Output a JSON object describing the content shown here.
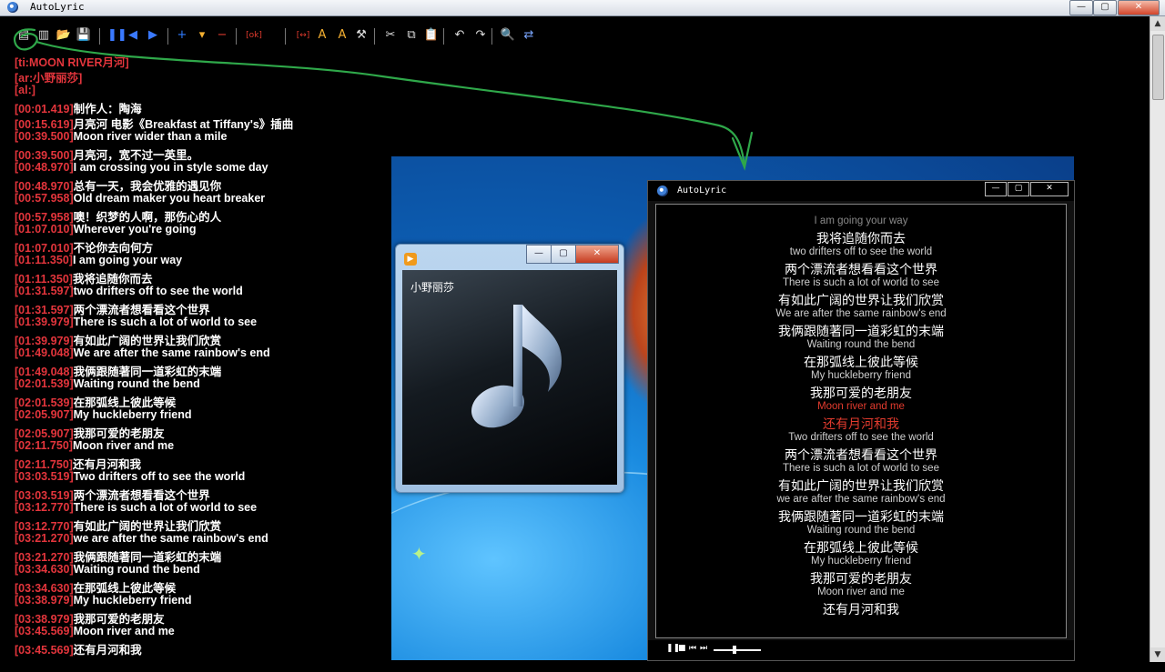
{
  "main_window": {
    "title": "AutoLyric",
    "controls": {
      "minimize": "—",
      "maximize": "▢",
      "close": "✕"
    }
  },
  "toolbar": {
    "buttons": [
      {
        "name": "new-icon",
        "glyph": "▤"
      },
      {
        "name": "list-icon",
        "glyph": "▥"
      },
      {
        "name": "open-icon",
        "glyph": "📂"
      },
      {
        "name": "save-icon",
        "glyph": "💾"
      },
      {
        "name": "pause-icon",
        "glyph": "❚❚"
      },
      {
        "name": "prev-icon",
        "glyph": "◀"
      },
      {
        "name": "next-icon",
        "glyph": "▶"
      },
      {
        "name": "add-icon",
        "glyph": "+"
      },
      {
        "name": "dropdown-icon",
        "glyph": "▾"
      },
      {
        "name": "remove-icon",
        "glyph": "−"
      },
      {
        "name": "ok-tag-icon",
        "glyph": "[ok]"
      },
      {
        "name": "range-icon",
        "glyph": "[↔]"
      },
      {
        "name": "font-size-down-icon",
        "glyph": "A"
      },
      {
        "name": "font-size-up-icon",
        "glyph": "A"
      },
      {
        "name": "tools-icon",
        "glyph": "⚒"
      },
      {
        "name": "cut-icon",
        "glyph": "✂"
      },
      {
        "name": "copy-icon",
        "glyph": "⧉"
      },
      {
        "name": "paste-icon",
        "glyph": "📋"
      },
      {
        "name": "undo-icon",
        "glyph": "↶"
      },
      {
        "name": "redo-icon",
        "glyph": "↷"
      },
      {
        "name": "find-icon",
        "glyph": "🔍"
      },
      {
        "name": "replace-icon",
        "glyph": "⇄"
      }
    ]
  },
  "editor": {
    "header_lines": [
      "[ti:MOON RIVER月河]",
      "[ar:小野丽莎]",
      "[al:]"
    ],
    "lines": [
      {
        "tag": "[00:01.419]",
        "text": "制作人：陶海"
      },
      {
        "tag": "[00:15.619]",
        "text": "月亮河 电影《Breakfast at Tiffany's》插曲"
      },
      {
        "tag": "[00:39.500]",
        "text": "Moon river wider than a mile"
      },
      {
        "tag": "[00:39.500]",
        "text": "月亮河，宽不过一英里。"
      },
      {
        "tag": "[00:48.970]",
        "text": "I am crossing you in style some day"
      },
      {
        "tag": "[00:48.970]",
        "text": "总有一天，我会优雅的遇见你"
      },
      {
        "tag": "[00:57.958]",
        "text": "Old dream maker  you heart breaker"
      },
      {
        "tag": "[00:57.958]",
        "text": "噢！织梦的人啊，那伤心的人"
      },
      {
        "tag": "[01:07.010]",
        "text": "Wherever you're going"
      },
      {
        "tag": "[01:07.010]",
        "text": "不论你去向何方"
      },
      {
        "tag": "[01:11.350]",
        "text": "I am going your way"
      },
      {
        "tag": "[01:11.350]",
        "text": "我将追随你而去"
      },
      {
        "tag": "[01:31.597]",
        "text": "two drifters off to see the world"
      },
      {
        "tag": "[01:31.597]",
        "text": "两个漂流者想看看这个世界"
      },
      {
        "tag": "[01:39.979]",
        "text": "There is such a lot of world to see"
      },
      {
        "tag": "[01:39.979]",
        "text": "有如此广阔的世界让我们欣赏"
      },
      {
        "tag": "[01:49.048]",
        "text": "We are after the same rainbow's end"
      },
      {
        "tag": "[01:49.048]",
        "text": "我俩跟随著同一道彩虹的末端"
      },
      {
        "tag": "[02:01.539]",
        "text": "Waiting round the bend"
      },
      {
        "tag": "[02:01.539]",
        "text": "在那弧线上彼此等候"
      },
      {
        "tag": "[02:05.907]",
        "text": "My huckleberry friend"
      },
      {
        "tag": "[02:05.907]",
        "text": "我那可爱的老朋友"
      },
      {
        "tag": "[02:11.750]",
        "text": "Moon river and me"
      },
      {
        "tag": "[02:11.750]",
        "text": "还有月河和我"
      },
      {
        "tag": "[03:03.519]",
        "text": "Two drifters off to see the world"
      },
      {
        "tag": "[03:03.519]",
        "text": "两个漂流者想看看这个世界"
      },
      {
        "tag": "[03:12.770]",
        "text": "There is such a lot of world to see"
      },
      {
        "tag": "[03:12.770]",
        "text": "有如此广阔的世界让我们欣赏"
      },
      {
        "tag": "[03:21.270]",
        "text": "we are after the same rainbow's end"
      },
      {
        "tag": "[03:21.270]",
        "text": "我俩跟随著同一道彩虹的末端"
      },
      {
        "tag": "[03:34.630]",
        "text": "Waiting round the bend"
      },
      {
        "tag": "[03:34.630]",
        "text": "在那弧线上彼此等候"
      },
      {
        "tag": "[03:38.979]",
        "text": "My huckleberry friend"
      },
      {
        "tag": "[03:38.979]",
        "text": "我那可爱的老朋友"
      },
      {
        "tag": "[03:45.569]",
        "text": "Moon river and me"
      },
      {
        "tag": "[03:45.569]",
        "text": "还有月河和我"
      }
    ],
    "scrollbar": {
      "up": "▲",
      "down": "▼"
    }
  },
  "media_player": {
    "artist": "小野丽莎",
    "controls": {
      "minimize": "—",
      "maximize": "▢",
      "close": "✕"
    },
    "icon_glyph": "▶"
  },
  "lyric_window": {
    "title": "AutoLyric",
    "controls": {
      "minimize": "—",
      "maximize": "▢",
      "close": "✕"
    },
    "lines": [
      {
        "text": "I am going your way",
        "lang": "en",
        "state": "dim"
      },
      {
        "text": "我将追随你而去",
        "lang": "zh",
        "state": "normal"
      },
      {
        "text": "two drifters off to see the world",
        "lang": "en",
        "state": "normal"
      },
      {
        "text": "两个漂流者想看看这个世界",
        "lang": "zh",
        "state": "normal"
      },
      {
        "text": "There is such a lot of world to see",
        "lang": "en",
        "state": "normal"
      },
      {
        "text": "有如此广阔的世界让我们欣赏",
        "lang": "zh",
        "state": "normal"
      },
      {
        "text": "We are after the same rainbow's end",
        "lang": "en",
        "state": "normal"
      },
      {
        "text": "我俩跟随著同一道彩虹的末端",
        "lang": "zh",
        "state": "normal"
      },
      {
        "text": "Waiting round the bend",
        "lang": "en",
        "state": "normal"
      },
      {
        "text": "在那弧线上彼此等候",
        "lang": "zh",
        "state": "normal"
      },
      {
        "text": "My huckleberry friend",
        "lang": "en",
        "state": "normal"
      },
      {
        "text": "我那可爱的老朋友",
        "lang": "zh",
        "state": "normal"
      },
      {
        "text": "Moon river and me",
        "lang": "en",
        "state": "current"
      },
      {
        "text": "还有月河和我",
        "lang": "zh",
        "state": "current"
      },
      {
        "text": "Two drifters off to see the world",
        "lang": "en",
        "state": "normal"
      },
      {
        "text": "两个漂流者想看看这个世界",
        "lang": "zh",
        "state": "normal"
      },
      {
        "text": "There is such a lot of world to see",
        "lang": "en",
        "state": "normal"
      },
      {
        "text": "有如此广阔的世界让我们欣赏",
        "lang": "zh",
        "state": "normal"
      },
      {
        "text": "we are after the same rainbow's end",
        "lang": "en",
        "state": "normal"
      },
      {
        "text": "我俩跟随著同一道彩虹的末端",
        "lang": "zh",
        "state": "normal"
      },
      {
        "text": "Waiting round the bend",
        "lang": "en",
        "state": "normal"
      },
      {
        "text": "在那弧线上彼此等候",
        "lang": "zh",
        "state": "normal"
      },
      {
        "text": "My huckleberry friend",
        "lang": "en",
        "state": "normal"
      },
      {
        "text": "我那可爱的老朋友",
        "lang": "zh",
        "state": "normal"
      },
      {
        "text": "Moon river and me",
        "lang": "en",
        "state": "normal"
      },
      {
        "text": "还有月河和我",
        "lang": "zh",
        "state": "normal"
      }
    ],
    "playback": {
      "pause": "❚❚",
      "stop": "■",
      "prev": "⏮",
      "next": "⏭",
      "position": 0.45
    }
  },
  "colors": {
    "timestamp": "#e3353c",
    "current_lyric": "#e23b2e",
    "annotation_arrow": "#2fa84a"
  }
}
